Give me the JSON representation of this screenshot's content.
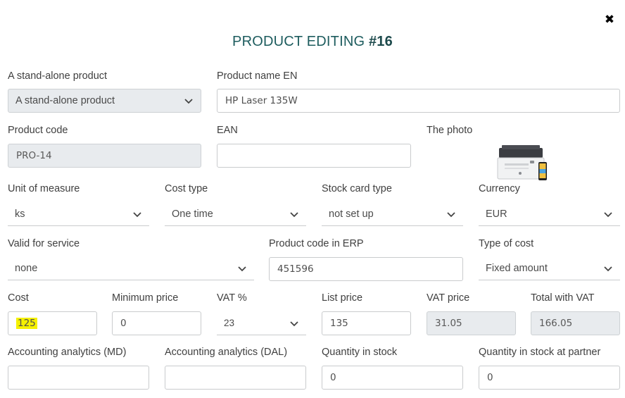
{
  "modal": {
    "title_prefix": "PRODUCT EDITING ",
    "title_id": "#16",
    "close_glyph": "✖"
  },
  "fields": {
    "standalone": {
      "label": "A stand-alone product",
      "value": "A stand-alone product"
    },
    "product_name": {
      "label": "Product name EN",
      "value": "HP Laser 135W"
    },
    "product_code": {
      "label": "Product code",
      "value": "PRO-14"
    },
    "ean": {
      "label": "EAN",
      "value": ""
    },
    "photo": {
      "label": "The photo",
      "icon": "printer-photo"
    },
    "unit": {
      "label": "Unit of measure",
      "value": "ks"
    },
    "cost_type": {
      "label": "Cost type",
      "value": "One time"
    },
    "stock_card": {
      "label": "Stock card type",
      "value": "not set up"
    },
    "currency": {
      "label": "Currency",
      "value": "EUR"
    },
    "valid_service": {
      "label": "Valid for service",
      "value": "none"
    },
    "erp_code": {
      "label": "Product code in ERP",
      "value": "451596"
    },
    "type_of_cost": {
      "label": "Type of cost",
      "value": "Fixed amount"
    },
    "cost": {
      "label": "Cost",
      "value": "125"
    },
    "min_price": {
      "label": "Minimum price",
      "value": "0"
    },
    "vat": {
      "label": "VAT %",
      "value": "23"
    },
    "list_price": {
      "label": "List price",
      "value": "135"
    },
    "vat_price": {
      "label": "VAT price",
      "value": "31.05"
    },
    "total_vat": {
      "label": "Total with VAT",
      "value": "166.05"
    },
    "acc_md": {
      "label": "Accounting analytics (MD)",
      "value": ""
    },
    "acc_dal": {
      "label": "Accounting analytics (DAL)",
      "value": ""
    },
    "qty_stock": {
      "label": "Quantity in stock",
      "value": "0"
    },
    "qty_partner": {
      "label": "Quantity in stock at partner",
      "value": "0"
    }
  },
  "colors": {
    "title": "#1d5c5e",
    "readonly_bg": "#e8ebee",
    "highlight": "#f5f100"
  }
}
